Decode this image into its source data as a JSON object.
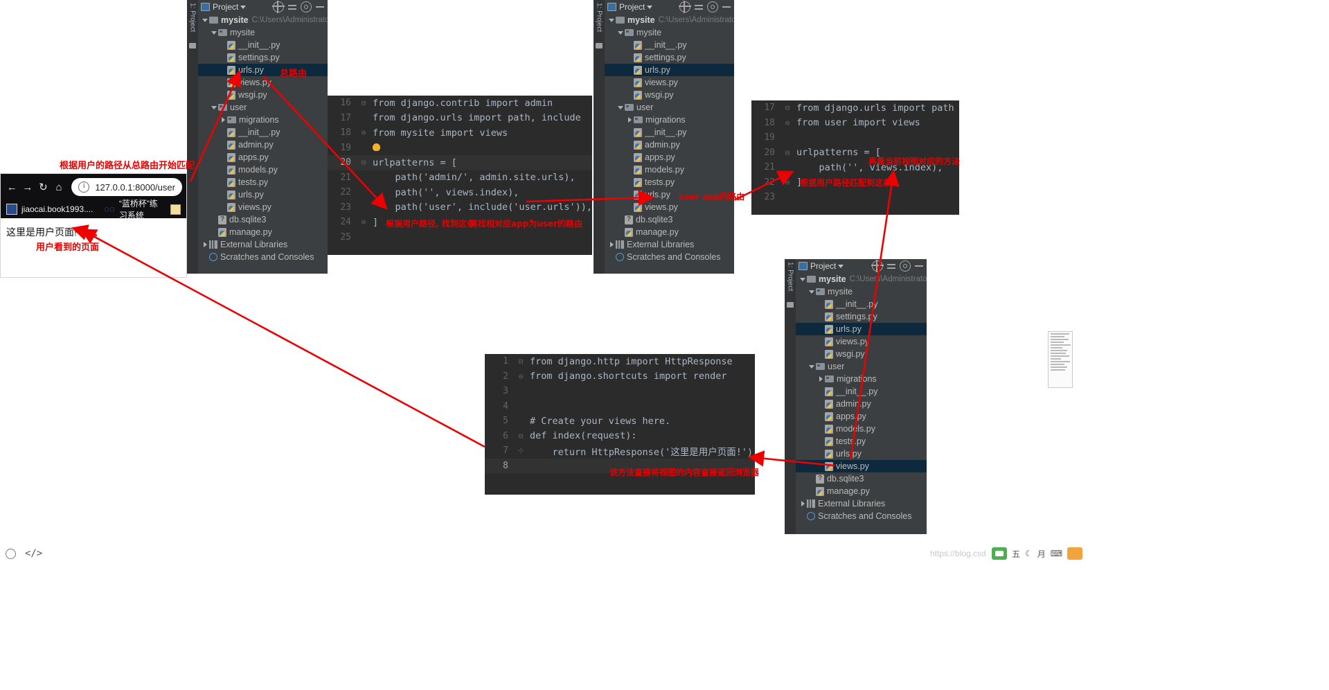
{
  "panels": {
    "project_tool_label": "1: Project",
    "toolbar": {
      "title": "Project",
      "icons": [
        "target-icon",
        "collapse-all-icon",
        "gear-icon",
        "minimize-icon"
      ]
    }
  },
  "tree1": {
    "nodes": [
      {
        "indent": 0,
        "twist": "down",
        "icon": "folder",
        "label": "mysite",
        "bold": true,
        "path": "C:\\Users\\Administrator"
      },
      {
        "indent": 1,
        "twist": "down",
        "icon": "folder",
        "label": "mysite"
      },
      {
        "indent": 2,
        "twist": "none",
        "icon": "py",
        "label": "__init__.py"
      },
      {
        "indent": 2,
        "twist": "none",
        "icon": "py",
        "label": "settings.py"
      },
      {
        "indent": 2,
        "twist": "none",
        "icon": "py",
        "label": "urls.py",
        "selected": true
      },
      {
        "indent": 2,
        "twist": "none",
        "icon": "py",
        "label": "views.py"
      },
      {
        "indent": 2,
        "twist": "none",
        "icon": "py",
        "label": "wsgi.py"
      },
      {
        "indent": 1,
        "twist": "down",
        "icon": "folder",
        "label": "user"
      },
      {
        "indent": 2,
        "twist": "right",
        "icon": "folder",
        "label": "migrations"
      },
      {
        "indent": 2,
        "twist": "none",
        "icon": "py",
        "label": "__init__.py"
      },
      {
        "indent": 2,
        "twist": "none",
        "icon": "py",
        "label": "admin.py"
      },
      {
        "indent": 2,
        "twist": "none",
        "icon": "py",
        "label": "apps.py"
      },
      {
        "indent": 2,
        "twist": "none",
        "icon": "py",
        "label": "models.py"
      },
      {
        "indent": 2,
        "twist": "none",
        "icon": "py",
        "label": "tests.py"
      },
      {
        "indent": 2,
        "twist": "none",
        "icon": "py",
        "label": "urls.py"
      },
      {
        "indent": 2,
        "twist": "none",
        "icon": "py",
        "label": "views.py"
      },
      {
        "indent": 1,
        "twist": "none",
        "icon": "db",
        "label": "db.sqlite3"
      },
      {
        "indent": 1,
        "twist": "none",
        "icon": "py",
        "label": "manage.py"
      },
      {
        "indent": 0,
        "twist": "right",
        "icon": "lib",
        "label": "External Libraries"
      },
      {
        "indent": 0,
        "twist": "none",
        "icon": "scratch",
        "label": "Scratches and Consoles"
      }
    ]
  },
  "tree2": {
    "nodes": [
      {
        "indent": 0,
        "twist": "down",
        "icon": "folder",
        "label": "mysite",
        "bold": true,
        "path": "C:\\Users\\Administrator"
      },
      {
        "indent": 1,
        "twist": "down",
        "icon": "folder",
        "label": "mysite"
      },
      {
        "indent": 2,
        "twist": "none",
        "icon": "py",
        "label": "__init__.py"
      },
      {
        "indent": 2,
        "twist": "none",
        "icon": "py",
        "label": "settings.py"
      },
      {
        "indent": 2,
        "twist": "none",
        "icon": "py",
        "label": "urls.py",
        "selected": true
      },
      {
        "indent": 2,
        "twist": "none",
        "icon": "py",
        "label": "views.py"
      },
      {
        "indent": 2,
        "twist": "none",
        "icon": "py",
        "label": "wsgi.py"
      },
      {
        "indent": 1,
        "twist": "down",
        "icon": "folder",
        "label": "user"
      },
      {
        "indent": 2,
        "twist": "right",
        "icon": "folder",
        "label": "migrations"
      },
      {
        "indent": 2,
        "twist": "none",
        "icon": "py",
        "label": "__init__.py"
      },
      {
        "indent": 2,
        "twist": "none",
        "icon": "py",
        "label": "admin.py"
      },
      {
        "indent": 2,
        "twist": "none",
        "icon": "py",
        "label": "apps.py"
      },
      {
        "indent": 2,
        "twist": "none",
        "icon": "py",
        "label": "models.py"
      },
      {
        "indent": 2,
        "twist": "none",
        "icon": "py",
        "label": "tests.py"
      },
      {
        "indent": 2,
        "twist": "none",
        "icon": "py",
        "label": "urls.py"
      },
      {
        "indent": 2,
        "twist": "none",
        "icon": "py",
        "label": "views.py"
      },
      {
        "indent": 1,
        "twist": "none",
        "icon": "db",
        "label": "db.sqlite3"
      },
      {
        "indent": 1,
        "twist": "none",
        "icon": "py",
        "label": "manage.py"
      },
      {
        "indent": 0,
        "twist": "right",
        "icon": "lib",
        "label": "External Libraries"
      },
      {
        "indent": 0,
        "twist": "none",
        "icon": "scratch",
        "label": "Scratches and Consoles"
      }
    ]
  },
  "tree3": {
    "nodes": [
      {
        "indent": 0,
        "twist": "down",
        "icon": "folder",
        "label": "mysite",
        "bold": true,
        "path": "C:\\Users\\Administrator"
      },
      {
        "indent": 1,
        "twist": "down",
        "icon": "folder",
        "label": "mysite"
      },
      {
        "indent": 2,
        "twist": "none",
        "icon": "py",
        "label": "__init__.py"
      },
      {
        "indent": 2,
        "twist": "none",
        "icon": "py",
        "label": "settings.py"
      },
      {
        "indent": 2,
        "twist": "none",
        "icon": "py",
        "label": "urls.py",
        "selected": true
      },
      {
        "indent": 2,
        "twist": "none",
        "icon": "py",
        "label": "views.py"
      },
      {
        "indent": 2,
        "twist": "none",
        "icon": "py",
        "label": "wsgi.py"
      },
      {
        "indent": 1,
        "twist": "down",
        "icon": "folder",
        "label": "user"
      },
      {
        "indent": 2,
        "twist": "right",
        "icon": "folder",
        "label": "migrations"
      },
      {
        "indent": 2,
        "twist": "none",
        "icon": "py",
        "label": "__init__.py"
      },
      {
        "indent": 2,
        "twist": "none",
        "icon": "py",
        "label": "admin.py"
      },
      {
        "indent": 2,
        "twist": "none",
        "icon": "py",
        "label": "apps.py"
      },
      {
        "indent": 2,
        "twist": "none",
        "icon": "py",
        "label": "models.py"
      },
      {
        "indent": 2,
        "twist": "none",
        "icon": "py",
        "label": "tests.py"
      },
      {
        "indent": 2,
        "twist": "none",
        "icon": "py",
        "label": "urls.py"
      },
      {
        "indent": 2,
        "twist": "none",
        "icon": "py",
        "label": "views.py",
        "selected2": true
      },
      {
        "indent": 1,
        "twist": "none",
        "icon": "db",
        "label": "db.sqlite3"
      },
      {
        "indent": 1,
        "twist": "none",
        "icon": "py",
        "label": "manage.py"
      },
      {
        "indent": 0,
        "twist": "right",
        "icon": "lib",
        "label": "External Libraries"
      },
      {
        "indent": 0,
        "twist": "none",
        "icon": "scratch",
        "label": "Scratches and Consoles"
      }
    ]
  },
  "editor_main": {
    "lines": [
      {
        "no": "16",
        "fold": "⊟",
        "text": "from django.contrib import admin"
      },
      {
        "no": "17",
        "fold": "",
        "text": "from django.urls import path, include"
      },
      {
        "no": "18",
        "fold": "⊖",
        "text": "from mysite import views"
      },
      {
        "no": "19",
        "fold": "",
        "text": ""
      },
      {
        "no": "20",
        "fold": "⊟",
        "text": "urlpatterns = [",
        "highlight": true
      },
      {
        "no": "21",
        "fold": "",
        "text": "    path('admin/', admin.site.urls),"
      },
      {
        "no": "22",
        "fold": "",
        "text": "    path('', views.index),"
      },
      {
        "no": "23",
        "fold": "",
        "text": "    path('user', include('user.urls')),"
      },
      {
        "no": "24",
        "fold": "⊖",
        "text": "]"
      },
      {
        "no": "25",
        "fold": "",
        "text": ""
      }
    ]
  },
  "editor_user_urls": {
    "lines": [
      {
        "no": "17",
        "fold": "⊟",
        "text": "from django.urls import path"
      },
      {
        "no": "18",
        "fold": "⊖",
        "text": "from user import views"
      },
      {
        "no": "19",
        "fold": "",
        "text": ""
      },
      {
        "no": "20",
        "fold": "⊟",
        "text": "urlpatterns = ["
      },
      {
        "no": "21",
        "fold": "",
        "text": "    path('', views.index),"
      },
      {
        "no": "22",
        "fold": "⊖",
        "text": "]"
      },
      {
        "no": "23",
        "fold": "",
        "text": ""
      }
    ]
  },
  "editor_views": {
    "lines": [
      {
        "no": "1",
        "fold": "⊟",
        "text": "from django.http import HttpResponse"
      },
      {
        "no": "2",
        "fold": "⊖",
        "text": "from django.shortcuts import render"
      },
      {
        "no": "3",
        "fold": "",
        "text": ""
      },
      {
        "no": "4",
        "fold": "",
        "text": ""
      },
      {
        "no": "5",
        "fold": "",
        "text": "# Create your views here."
      },
      {
        "no": "6",
        "fold": "⊟",
        "text": "def index(request):"
      },
      {
        "no": "7",
        "fold": "⊹",
        "text": "    return HttpResponse('这里是用户页面!')"
      },
      {
        "no": "8",
        "fold": "",
        "text": "",
        "highlight": true
      }
    ]
  },
  "browser": {
    "back_icon": "back-arrow-icon",
    "forward_icon": "forward-arrow-icon",
    "reload_icon": "reload-icon",
    "home_icon": "home-icon",
    "url": "127.0.0.1:8000/user",
    "info_glyph": "i",
    "bookmarks": [
      {
        "label": "jiaocai.book1993....",
        "icon": "bookmark-favicon"
      },
      {
        "label": "“蓝桥杯”练习系统",
        "icon": "bookmark-favicon-rings"
      },
      {
        "label": "",
        "icon": "bookmark-favicon-note"
      }
    ],
    "page_text": "这里是用户页面!"
  },
  "annotations": {
    "total_route": "总路由",
    "match_from_root": "根据用户的路径从总路由开始匹配",
    "user_sees_page": "用户看到的页面",
    "find_this_entry": "根据用户路径, 找到这条",
    "find_app_route": "再找相对应app为user的路由",
    "user_app_route": "user app的路由",
    "match_this_entry": "根据用户路径匹配到这条",
    "current_view_method": "再看当前视图对应的方法",
    "direct_return": "该方法直接将视图的内容直接返回浏览器"
  },
  "watermark": "https://blog.csd",
  "taskbar": {
    "items": [
      "五",
      "月",
      "输入法",
      "工具"
    ]
  }
}
